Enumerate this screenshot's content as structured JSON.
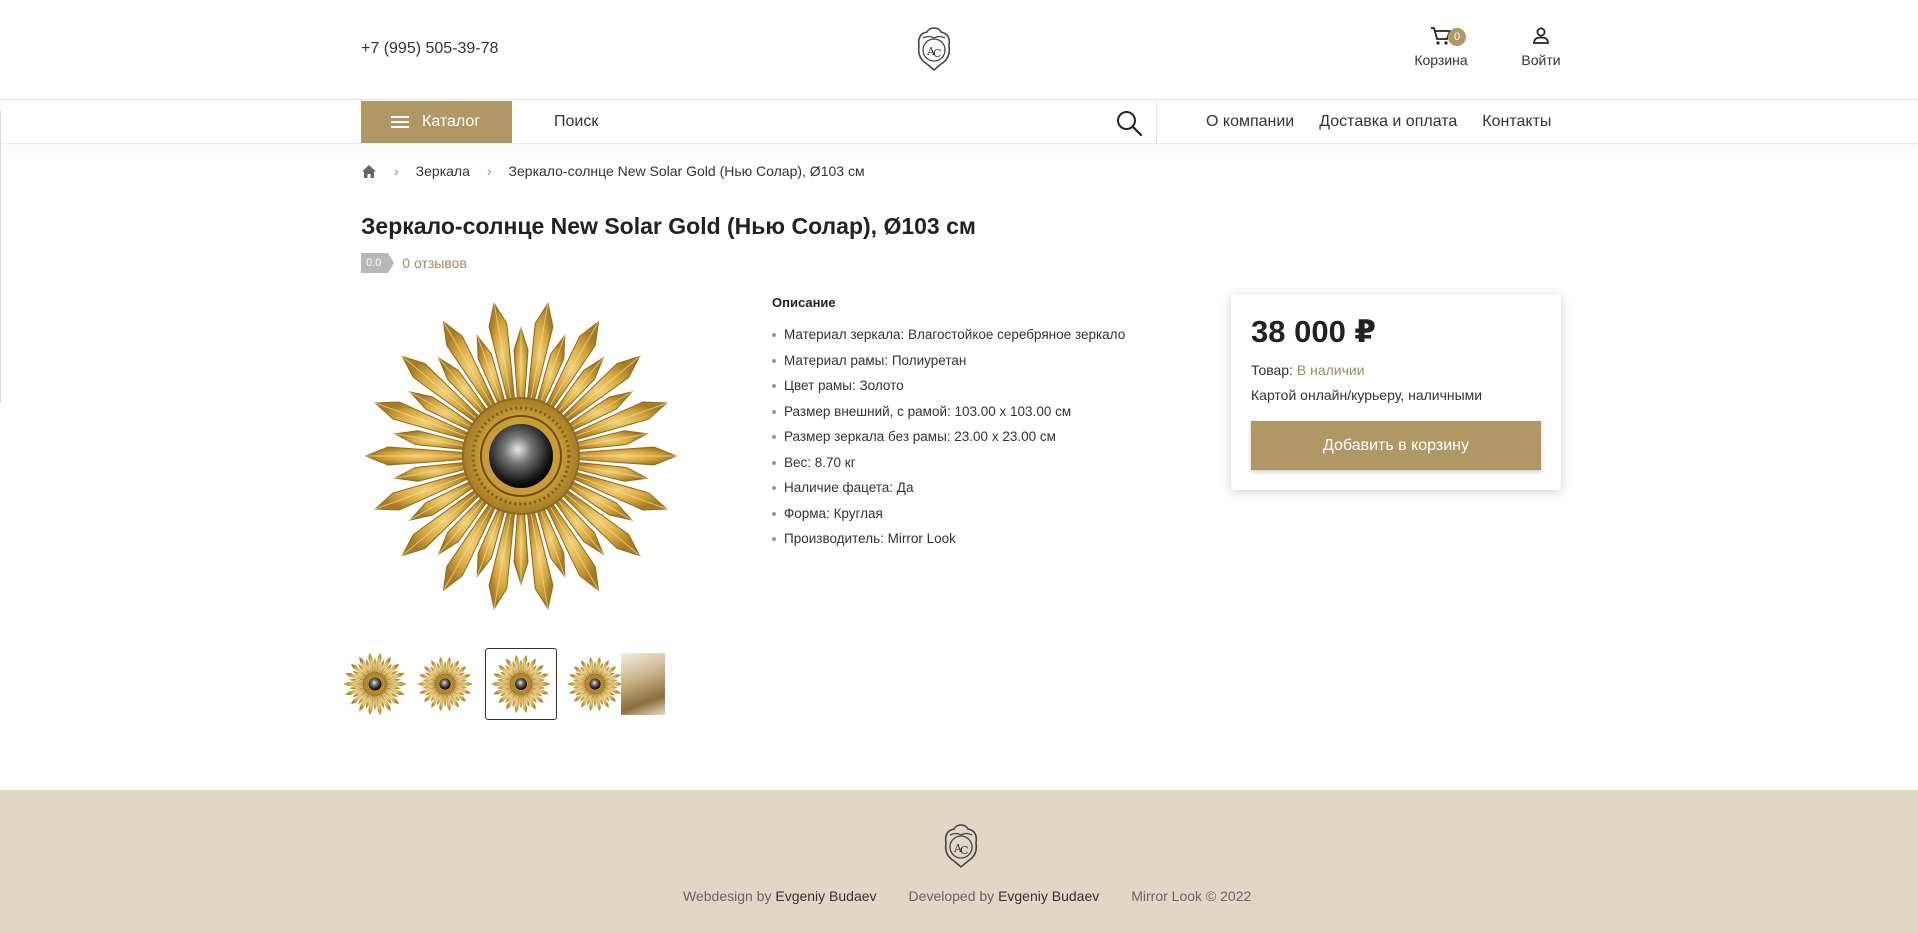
{
  "header": {
    "phone": "+7 (995) 505-39-78",
    "cart_label": "Корзина",
    "cart_count": "0",
    "login_label": "Войти"
  },
  "nav": {
    "catalog_label": "Каталог",
    "search_placeholder": "Поиск",
    "links": [
      "О компании",
      "Доставка и оплата",
      "Контакты"
    ]
  },
  "breadcrumb": {
    "items": [
      "Зеркала",
      "Зеркало-солнце New Solar Gold (Нью Солар), Ø103 см"
    ]
  },
  "product": {
    "title": "Зеркало-солнце New Solar Gold (Нью Солар), Ø103 см",
    "rating": "0.0",
    "reviews": "0 отзывов",
    "description_title": "Описание",
    "description": [
      "Материал зеркала: Влагостойкое серебряное зеркало",
      "Материал рамы: Полиуретан",
      "Цвет рамы: Золото",
      "Размер внешний, с рамой: 103.00 x 103.00 см",
      "Размер зеркала без рамы: 23.00 x 23.00 см",
      "Вес: 8.70 кг",
      "Наличие фацета: Да",
      "Форма: Круглая",
      "Производитель: Mirror Look"
    ],
    "thumbnail_count": 5,
    "active_thumbnail": 3
  },
  "price_card": {
    "price": "38 000 ₽",
    "stock_label": "Товар:",
    "stock_value": "В наличии",
    "payment": "Картой онлайн/курьеру, наличными",
    "add_to_cart": "Добавить в корзину"
  },
  "footer": {
    "webdesign_label": "Webdesign by",
    "webdesign_author": "Evgeniy Budaev",
    "developed_label": "Developed by",
    "developed_author": "Evgeniy Budaev",
    "copyright": "Mirror Look © 2022"
  },
  "colors": {
    "accent": "#b09766",
    "accent_text": "#a08b62",
    "footer_bg": "#e1d7c5"
  }
}
